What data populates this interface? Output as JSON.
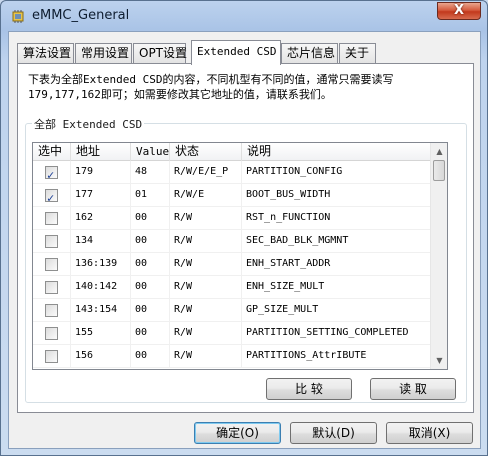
{
  "window": {
    "title": "eMMC_General",
    "close_glyph": "X",
    "app_icon": "chip-icon"
  },
  "tabs": [
    {
      "label": "算法设置",
      "active": false
    },
    {
      "label": "常用设置",
      "active": false
    },
    {
      "label": "OPT设置",
      "active": false
    },
    {
      "label": "Extended CSD",
      "active": true
    },
    {
      "label": "芯片信息",
      "active": false
    },
    {
      "label": "关于",
      "active": false
    }
  ],
  "panel": {
    "description": "下表为全部Extended CSD的内容，不同机型有不同的值，通常只需要读写\n179,177,162即可；如需要修改其它地址的值，请联系我们。",
    "group_label": "全部 Extended CSD"
  },
  "table": {
    "headers": [
      "选中",
      "地址",
      "Value",
      "状态",
      "说明"
    ],
    "rows": [
      {
        "checked": true,
        "address": "179",
        "value": "48",
        "status": "R/W/E/E_P",
        "desc": "PARTITION_CONFIG"
      },
      {
        "checked": true,
        "address": "177",
        "value": "01",
        "status": "R/W/E",
        "desc": "BOOT_BUS_WIDTH"
      },
      {
        "checked": false,
        "address": "162",
        "value": "00",
        "status": "R/W",
        "desc": "RST_n_FUNCTION"
      },
      {
        "checked": false,
        "address": "134",
        "value": "00",
        "status": "R/W",
        "desc": "SEC_BAD_BLK_MGMNT"
      },
      {
        "checked": false,
        "address": "136:139",
        "value": "00",
        "status": "R/W",
        "desc": "ENH_START_ADDR"
      },
      {
        "checked": false,
        "address": "140:142",
        "value": "00",
        "status": "R/W",
        "desc": "ENH_SIZE_MULT"
      },
      {
        "checked": false,
        "address": "143:154",
        "value": "00",
        "status": "R/W",
        "desc": "GP_SIZE_MULT"
      },
      {
        "checked": false,
        "address": "155",
        "value": "00",
        "status": "R/W",
        "desc": "PARTITION_SETTING_COMPLETED"
      },
      {
        "checked": false,
        "address": "156",
        "value": "00",
        "status": "R/W",
        "desc": "PARTITIONS_AttrIBUTE"
      }
    ],
    "scroll_up": "▲",
    "scroll_down": "▼"
  },
  "actions": {
    "compare_label": "比 较",
    "read_label": "读 取"
  },
  "footer": {
    "ok_label": "确定(O)",
    "default_label": "默认(D)",
    "cancel_label": "取消(X)"
  }
}
